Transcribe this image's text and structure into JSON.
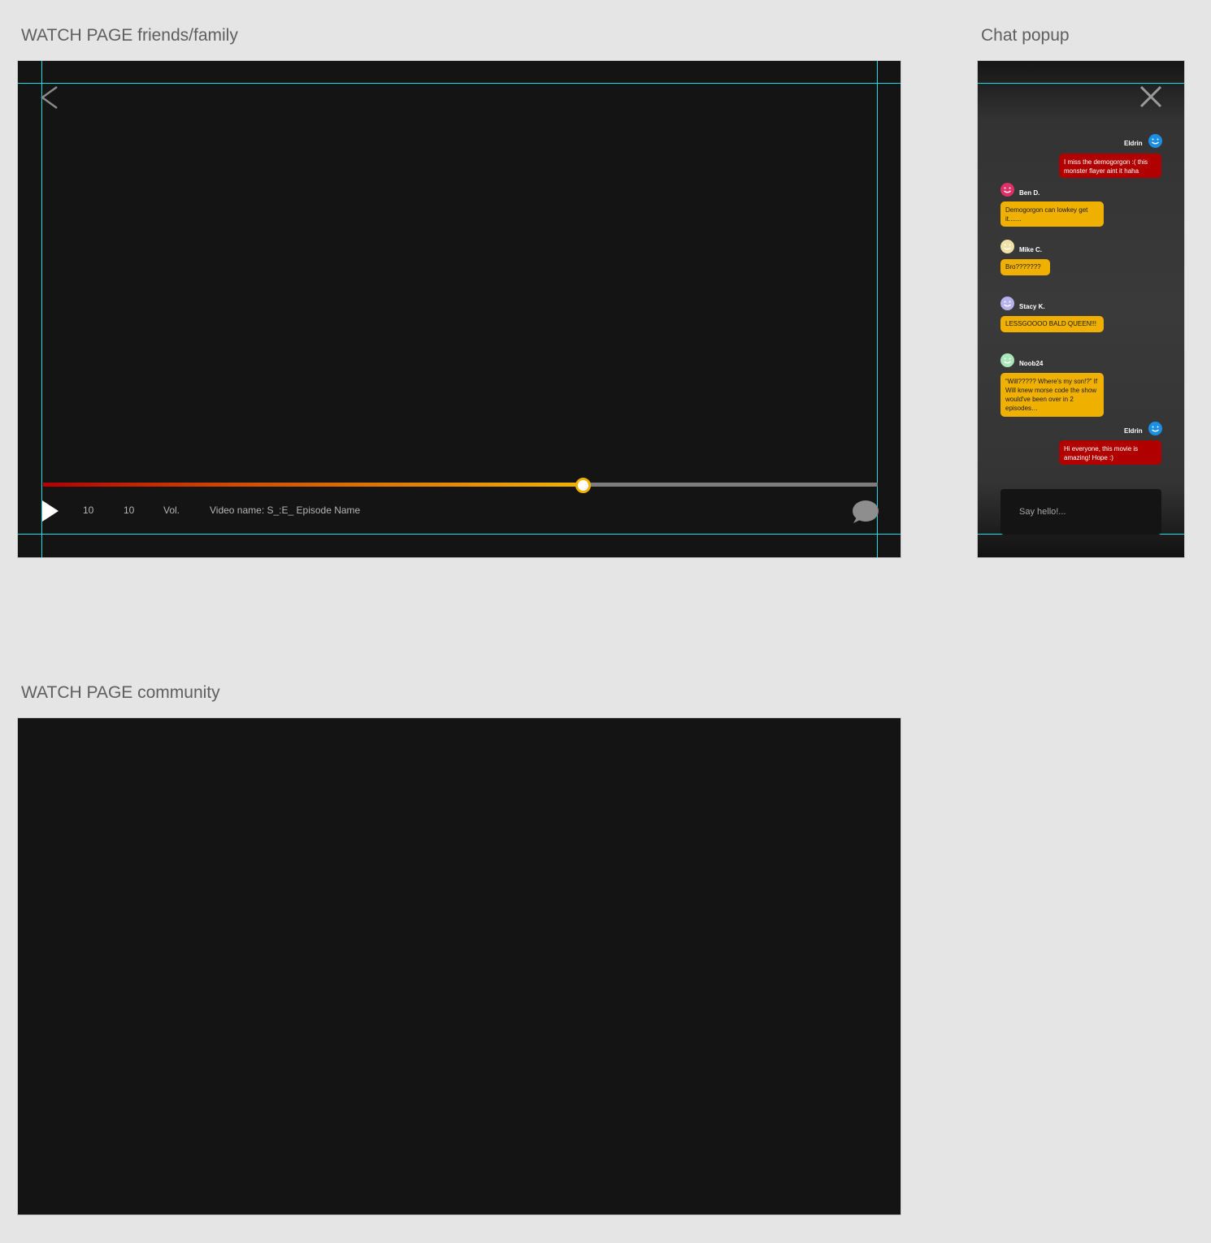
{
  "artboards": {
    "watch_title": "WATCH PAGE friends/family",
    "chat_title": "Chat popup",
    "community_title": "WATCH PAGE community"
  },
  "player": {
    "progress": 0.647,
    "skip_back": "10",
    "skip_forward": "10",
    "volume_label": "Vol.",
    "video_name": "Video name: S_:E_ Episode Name"
  },
  "chat": {
    "messages": [
      {
        "name": "Eldrin",
        "text": "I miss the demogorgon :( this monster flayer aint it haha",
        "side": "right",
        "color": "red",
        "avatar_color": "#1a8fe3"
      },
      {
        "name": "Ben D.",
        "text": "Demogorgon can lowkey get it.......",
        "side": "left",
        "color": "yellow",
        "avatar_color": "#e0306a"
      },
      {
        "name": "Mike C.",
        "text": "Bro???????",
        "side": "left",
        "color": "yellow",
        "avatar_color": "#efe0a6"
      },
      {
        "name": "Stacy K.",
        "text": "LESSGOOOO BALD QUEEN!!!",
        "side": "left",
        "color": "yellow",
        "avatar_color": "#b7b2ec"
      },
      {
        "name": "Noob24",
        "text": "“Will????? Where's my son!?” If Will knew morse code the show would've been over in 2 episodes…",
        "side": "left",
        "color": "yellow",
        "avatar_color": "#a9e6b8"
      },
      {
        "name": "Eldrin",
        "text": "Hi everyone, this movie is amazing! Hope :)",
        "side": "right",
        "color": "red",
        "avatar_color": "#1a8fe3"
      }
    ],
    "input_placeholder": "Say hello!..."
  },
  "colors": {
    "accent_red": "#b00000",
    "accent_yellow": "#f0b000",
    "guide": "#19e0e8",
    "player_bg": "#141414"
  }
}
